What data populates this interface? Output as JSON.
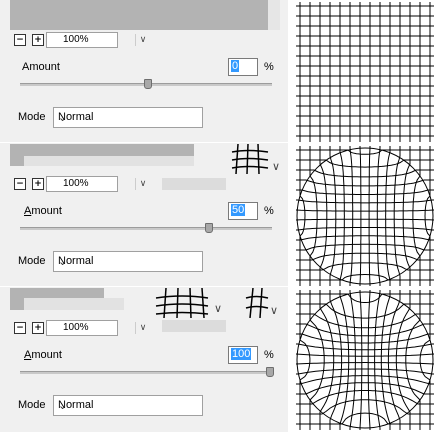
{
  "panels": [
    {
      "zoom": "100%",
      "amount_label_pre": "",
      "amount_label_ul": "",
      "amount_label_plain": "Amount",
      "amount_value": "0",
      "percent": "%",
      "mode_label": "Mode",
      "mode_value": "Normal",
      "slider_fraction": 0.5
    },
    {
      "zoom": "100%",
      "amount_label_pre": "",
      "amount_label_ul": "A",
      "amount_label_plain": "mount",
      "amount_value": "50",
      "percent": "%",
      "mode_label": "Mode",
      "mode_value": "Normal",
      "slider_fraction": 0.75
    },
    {
      "zoom": "100%",
      "amount_label_pre": "",
      "amount_label_ul": "A",
      "amount_label_plain": "mount",
      "amount_value": "100",
      "percent": "%",
      "mode_label": "Mode",
      "mode_value": "Normal",
      "slider_fraction": 1.0
    }
  ],
  "icons": {
    "zoom_out": "minus-icon",
    "zoom_in": "plus-icon",
    "dropdown": "chevron-down-icon"
  },
  "glyphs": {
    "minus": "−",
    "plus": "+",
    "chevron": "⌄",
    "chevron_small": "∨"
  }
}
